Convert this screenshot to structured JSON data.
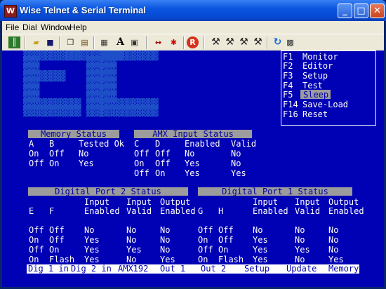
{
  "window": {
    "title": "Wise Telnet & Serial Terminal"
  },
  "menu": [
    "File",
    "Dial",
    "Window",
    "Help"
  ],
  "toolbar_icons": [
    "connect-icon",
    "open-folder-icon",
    "save-icon",
    "copy-icon",
    "paste-icon",
    "print-icon",
    "font-icon",
    "properties-icon",
    "send-arrows-icon",
    "capture-icon",
    "record-icon",
    "hammer-1-icon",
    "hammer-2-icon",
    "hammer-3-icon",
    "hammer-4-icon",
    "refresh-icon",
    "settings-icon"
  ],
  "logo_text": "ETC",
  "fkeys": [
    {
      "key": "F1",
      "label": "Monitor"
    },
    {
      "key": "F2",
      "label": "Editor"
    },
    {
      "key": "F3",
      "label": "Setup"
    },
    {
      "key": "F4",
      "label": "Test"
    },
    {
      "key": "F5",
      "label": "Sleep"
    },
    {
      "key": "F14",
      "label": "Save-Load"
    },
    {
      "key": "F16",
      "label": "Reset"
    }
  ],
  "memory": {
    "title": "Memory Status",
    "headers": [
      "A",
      "B",
      "Tested Ok"
    ],
    "rows": [
      [
        "On",
        "Off",
        "No"
      ],
      [
        "Off",
        "On",
        "Yes"
      ]
    ]
  },
  "amx": {
    "title": "AMX Input Status",
    "headers": [
      "C",
      "D",
      "Enabled",
      "Valid"
    ],
    "rows": [
      [
        "Off",
        "Off",
        "No",
        "No"
      ],
      [
        "On",
        "Off",
        "Yes",
        "No"
      ],
      [
        "Off",
        "On",
        "Yes",
        "Yes"
      ]
    ]
  },
  "port2": {
    "title": "Digital Port 2 Status",
    "headers_top": [
      "Input",
      "Input",
      "Output"
    ],
    "headers": [
      "E",
      "F",
      "Enabled",
      "Valid",
      "Enabled"
    ],
    "rows": [
      [
        "Off",
        "Off",
        "No",
        "No",
        "No"
      ],
      [
        "On",
        "Off",
        "Yes",
        "No",
        "No"
      ],
      [
        "Off",
        "On",
        "Yes",
        "Yes",
        "No"
      ],
      [
        "On",
        "Flash",
        "Yes",
        "No",
        "Yes"
      ]
    ]
  },
  "port1": {
    "title": "Digital Port 1 Status",
    "headers_top": [
      "Input",
      "Input",
      "Output"
    ],
    "headers": [
      "G",
      "H",
      "Enabled",
      "Valid",
      "Enabled"
    ],
    "rows": [
      [
        "Off",
        "Off",
        "No",
        "No",
        "No"
      ],
      [
        "On",
        "Off",
        "Yes",
        "No",
        "No"
      ],
      [
        "Off",
        "On",
        "Yes",
        "Yes",
        "No"
      ],
      [
        "On",
        "Flash",
        "Yes",
        "No",
        "Yes"
      ]
    ]
  },
  "status_bar": [
    "Dig 1 in",
    "Dig 2 in",
    "AMX192",
    "Out 1",
    "Out 2",
    "Setup",
    "Update",
    "Memory"
  ]
}
